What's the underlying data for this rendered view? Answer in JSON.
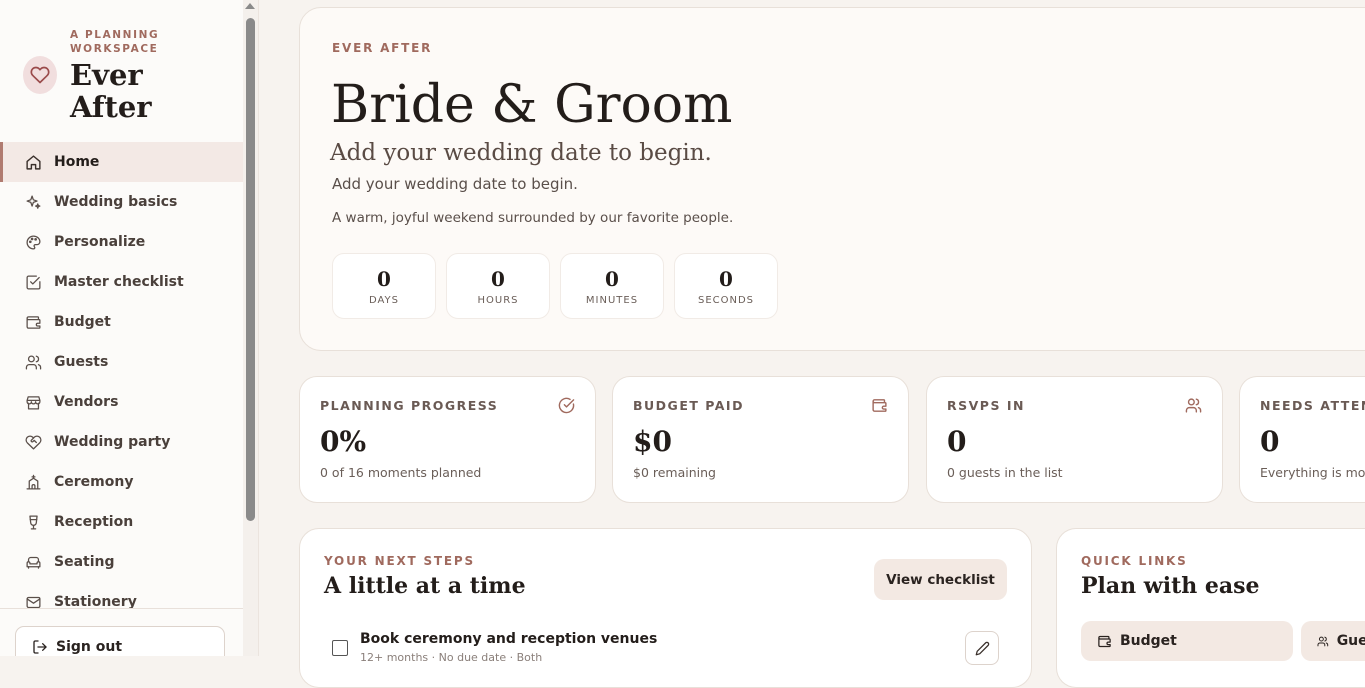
{
  "brand": {
    "subtitle": "A PLANNING WORKSPACE",
    "title": "Ever After"
  },
  "sidebar": {
    "items": [
      {
        "label": "Home",
        "icon": "home-icon",
        "active": true
      },
      {
        "label": "Wedding basics",
        "icon": "sparkles-icon"
      },
      {
        "label": "Personalize",
        "icon": "palette-icon"
      },
      {
        "label": "Master checklist",
        "icon": "checkbox-icon"
      },
      {
        "label": "Budget",
        "icon": "wallet-icon"
      },
      {
        "label": "Guests",
        "icon": "users-icon"
      },
      {
        "label": "Vendors",
        "icon": "store-icon"
      },
      {
        "label": "Wedding party",
        "icon": "heart-handshake-icon"
      },
      {
        "label": "Ceremony",
        "icon": "church-icon"
      },
      {
        "label": "Reception",
        "icon": "glass-icon"
      },
      {
        "label": "Seating",
        "icon": "sofa-icon"
      },
      {
        "label": "Stationery",
        "icon": "mail-icon"
      }
    ],
    "sign_out": "Sign out"
  },
  "hero": {
    "eyebrow": "EVER AFTER",
    "title": "Bride & Groom",
    "subtitle_serif": "Add your wedding date to begin.",
    "subtitle": "Add your wedding date to begin.",
    "tagline": "A warm, joyful weekend surrounded by our favorite people.",
    "countdown": [
      {
        "value": "0",
        "label": "DAYS"
      },
      {
        "value": "0",
        "label": "HOURS"
      },
      {
        "value": "0",
        "label": "MINUTES"
      },
      {
        "value": "0",
        "label": "SECONDS"
      }
    ]
  },
  "stats": [
    {
      "label": "PLANNING PROGRESS",
      "value": "0%",
      "sub": "0 of 16 moments planned",
      "icon": "circle-check-icon"
    },
    {
      "label": "BUDGET PAID",
      "value": "$0",
      "sub": "$0 remaining",
      "icon": "wallet-icon"
    },
    {
      "label": "RSVPS IN",
      "value": "0",
      "sub": "0 guests in the list",
      "icon": "users-icon"
    },
    {
      "label": "NEEDS ATTENTION",
      "value": "0",
      "sub": "Everything is moving",
      "icon": "alert-icon"
    }
  ],
  "next_steps": {
    "eyebrow": "YOUR NEXT STEPS",
    "title": "A little at a time",
    "button": "View checklist",
    "task": {
      "title": "Book ceremony and reception venues",
      "meta": "12+ months · No due date · Both"
    }
  },
  "quick_links": {
    "eyebrow": "QUICK LINKS",
    "title": "Plan with ease",
    "links": [
      {
        "label": "Budget",
        "icon": "wallet-icon"
      },
      {
        "label": "Guests",
        "icon": "users-icon"
      }
    ]
  },
  "colors": {
    "accent": "#a06a5e",
    "background": "#f7f3ef",
    "card": "#ffffff",
    "soft": "#f3e9e3"
  }
}
